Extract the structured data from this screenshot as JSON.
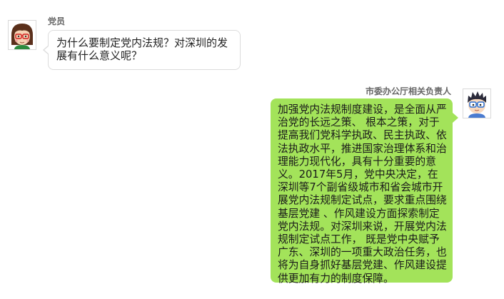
{
  "messages": [
    {
      "sender": "党员",
      "side": "left",
      "avatar": "girl-with-glasses-avatar",
      "text": "为什么要制定党内法规？对深圳的发展有什么意义呢？"
    },
    {
      "sender": "市委办公厅相关负责人",
      "side": "right",
      "avatar": "boy-with-glasses-avatar",
      "text": "加强党内法规制度建设，是全面从严治党的长远之策、 根本之策，对于提高我们党科学执政、民主执政、依法执政水平，推进国家治理体系和治理能力现代化，具有十分重要的意义。2017年5月，党中央决定，在深圳等7个副省级城市和省会城市开展党内法规制定试点，要求重点围绕基层党建 、作风建设方面探索制定党内法规。对深圳来说，开展党内法规制定试点工作， 既是党中央赋予广东、深圳的一项重大政治任务，也将为自身抓好基层党建、作风建设提供更加有力的制度保障。"
    }
  ],
  "colors": {
    "left_bubble_bg": "#ffffff",
    "left_bubble_border": "#dcdcdc",
    "right_bubble_bg": "#a3e35a",
    "sender_name": "#666666"
  }
}
